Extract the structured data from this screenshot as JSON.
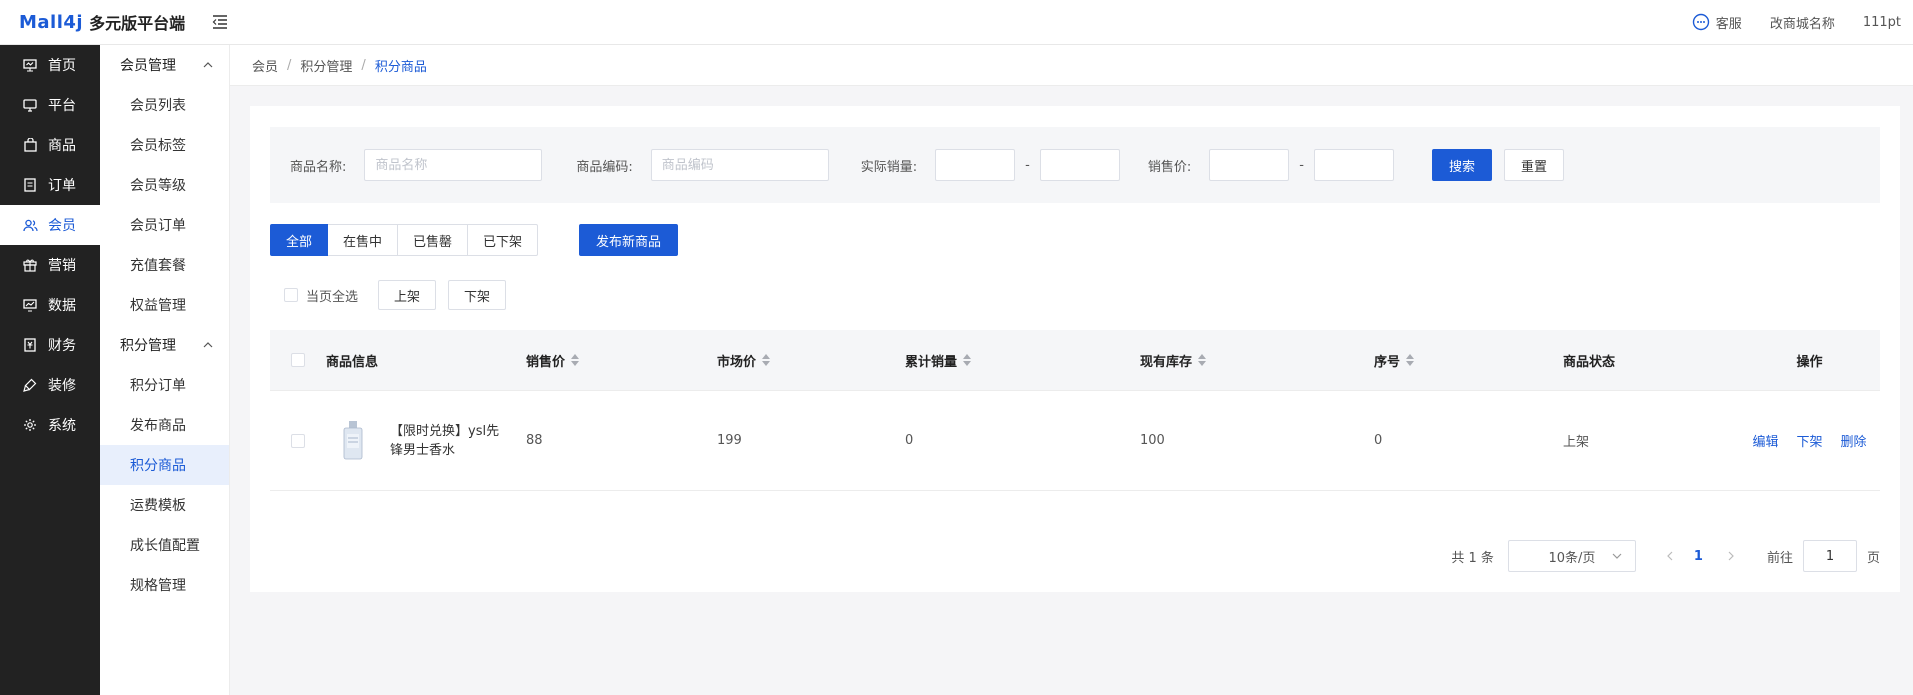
{
  "header": {
    "logo_brand": "Mall4j",
    "logo_sub": "多元版平台端",
    "service_label": "客服",
    "shop_label": "改商城名称",
    "user_label": "111pt"
  },
  "side1": {
    "items": [
      {
        "label": "首页",
        "icon": "monitor-icon"
      },
      {
        "label": "平台",
        "icon": "screen-icon"
      },
      {
        "label": "商品",
        "icon": "bag-icon"
      },
      {
        "label": "订单",
        "icon": "order-icon"
      },
      {
        "label": "会员",
        "icon": "users-icon"
      },
      {
        "label": "营销",
        "icon": "gift-icon"
      },
      {
        "label": "数据",
        "icon": "chart-icon"
      },
      {
        "label": "财务",
        "icon": "wallet-icon"
      },
      {
        "label": "装修",
        "icon": "brush-icon"
      },
      {
        "label": "系统",
        "icon": "gear-icon"
      }
    ]
  },
  "side2": {
    "group1": "会员管理",
    "group1_items": [
      "会员列表",
      "会员标签",
      "会员等级",
      "会员订单",
      "充值套餐",
      "权益管理"
    ],
    "group2": "积分管理",
    "group2_items": [
      "积分订单",
      "发布商品",
      "积分商品",
      "运费模板",
      "成长值配置",
      "规格管理"
    ]
  },
  "breadcrumb": [
    "会员",
    "积分管理",
    "积分商品"
  ],
  "filter": {
    "name_label": "商品名称:",
    "name_placeholder": "商品名称",
    "code_label": "商品编码:",
    "code_placeholder": "商品编码",
    "sales_label": "实际销量:",
    "price_label": "销售价:",
    "dash": "-",
    "search_btn": "搜索",
    "reset_btn": "重置"
  },
  "tabs": [
    "全部",
    "在售中",
    "已售罄",
    "已下架"
  ],
  "publish_btn": "发布新商品",
  "batch": {
    "select_all": "当页全选",
    "on_btn": "上架",
    "off_btn": "下架"
  },
  "table": {
    "headers": [
      "商品信息",
      "销售价",
      "市场价",
      "累计销量",
      "现有库存",
      "序号",
      "商品状态",
      "操作"
    ],
    "rows": [
      {
        "name": "【限时兑换】ysl先锋男士香水",
        "price": "88",
        "market": "199",
        "sold": "0",
        "stock": "100",
        "seq": "0",
        "status": "上架",
        "ops": [
          "编辑",
          "下架",
          "删除"
        ]
      }
    ]
  },
  "pager": {
    "total": "共 1 条",
    "size": "10条/页",
    "current": "1",
    "goto_label": "前往",
    "goto_value": "1",
    "page_suffix": "页"
  },
  "colors": {
    "accent": "#1c5bd6",
    "sidebar_bg": "#222222",
    "filter_bg": "#f5f6f8"
  }
}
